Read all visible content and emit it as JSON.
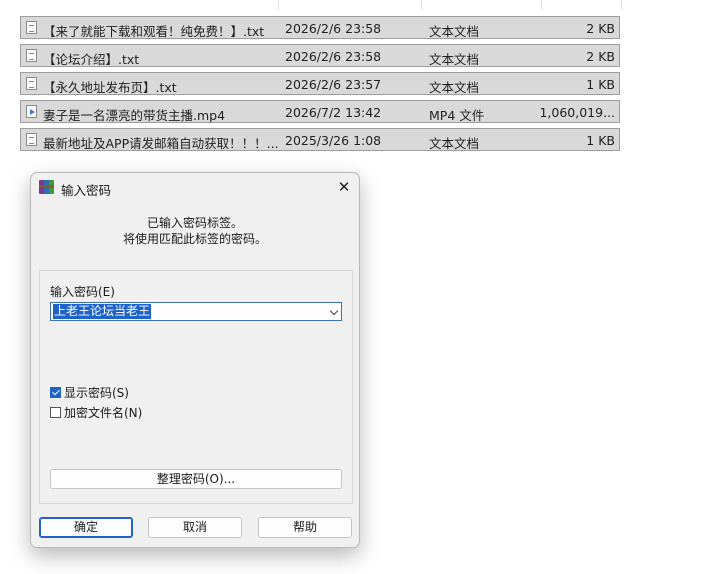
{
  "files": [
    {
      "icon": "txt-file-icon",
      "name": "【来了就能下载和观看！纯免费！】.txt",
      "date": "2026/2/6 23:58",
      "type": "文本文档",
      "size": "2 KB"
    },
    {
      "icon": "txt-file-icon",
      "name": "【论坛介绍】.txt",
      "date": "2026/2/6 23:58",
      "type": "文本文档",
      "size": "2 KB"
    },
    {
      "icon": "txt-file-icon",
      "name": "【永久地址发布页】.txt",
      "date": "2026/2/6 23:57",
      "type": "文本文档",
      "size": "1 KB"
    },
    {
      "icon": "video-file-icon",
      "name": "妻子是一名漂亮的带货主播.mp4",
      "date": "2026/7/2 13:42",
      "type": "MP4 文件",
      "size": "1,060,019..."
    },
    {
      "icon": "txt-file-icon",
      "name": "最新地址及APP请发邮箱自动获取！！！....",
      "date": "2025/3/26 1:08",
      "type": "文本文档",
      "size": "1 KB"
    }
  ],
  "dialog": {
    "title": "输入密码",
    "message_line1": "已输入密码标签。",
    "message_line2": "将使用匹配此标签的密码。",
    "password_label": "输入密码(E)",
    "password_value": "上老王论坛当老王",
    "show_password_label": "显示密码(S)",
    "show_password_checked": true,
    "encrypt_filenames_label": "加密文件名(N)",
    "encrypt_filenames_checked": false,
    "organize_label": "整理密码(O)...",
    "ok_label": "确定",
    "cancel_label": "取消",
    "help_label": "帮助"
  },
  "colors": {
    "accent": "#1e64c8",
    "row_bg": "#d9d9d9",
    "dialog_bg": "#f0f0f0"
  }
}
